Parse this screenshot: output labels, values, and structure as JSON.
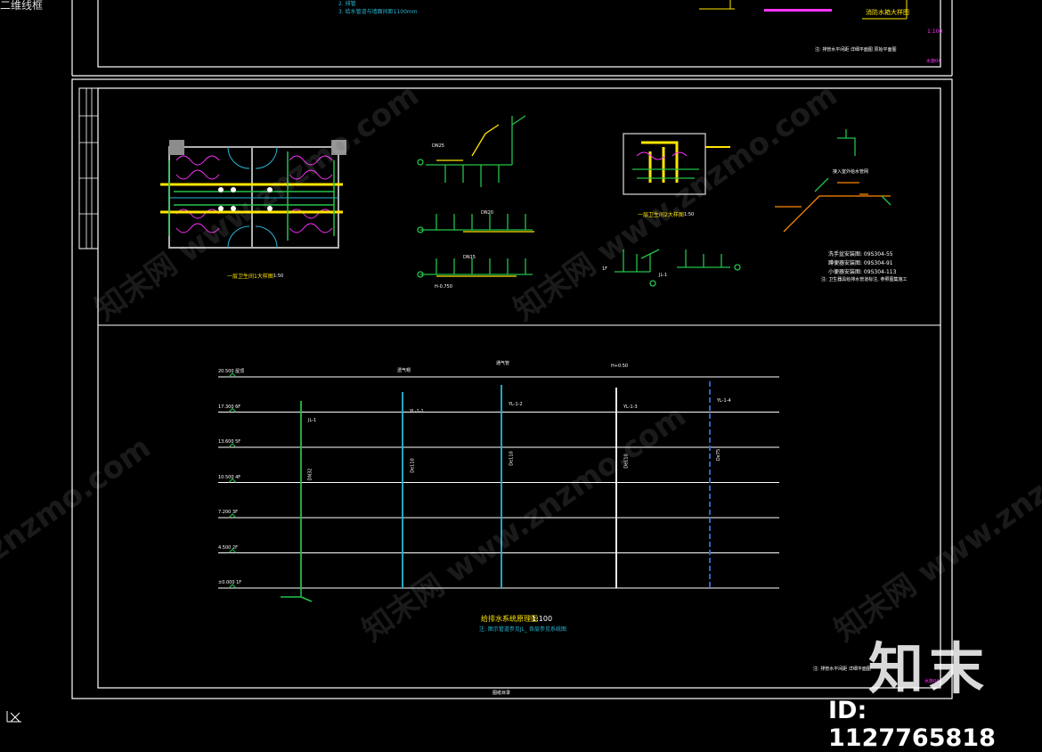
{
  "ui": {
    "viewport_label": "二维线框",
    "ucs_icon": "ucs-axis-icon"
  },
  "top_sheet": {
    "notes": [
      "2. 排管",
      "3. 给水管道与墙面间距1100mm"
    ],
    "title": "消防水箱大样图",
    "scale": "1:100",
    "sheet_no": "水施04",
    "footer": "注: 排管水平间距  详细平面图 原始平面图"
  },
  "sheet": {
    "plan1_title": "一层卫生间1大样图",
    "plan1_scale": "1:50",
    "plan2_title": "一层卫生间2大样图",
    "plan2_scale": "1:50",
    "atlas_lines": [
      "洗手盆安装图: 09S304-55",
      "蹲便器安装图: 09S304-91",
      "小便器安装图: 09S304-113"
    ],
    "atlas_note": "注: 卫生器具给排水管道标注, 参照图集施工",
    "riser_title": "给排水系统原理图",
    "riser_scale": "1:100",
    "riser_note": "注: 图示管道参见JL_ 各层参见系统图",
    "footer_note": "注: 排管水平间距  详细平面图",
    "sheet_no": "水施04",
    "bottom_label": "图纸目录"
  },
  "floors": [
    {
      "elev": "20.500",
      "name": "屋顶"
    },
    {
      "elev": "17.300",
      "name": "6F"
    },
    {
      "elev": "13.600",
      "name": "5F"
    },
    {
      "elev": "10.500",
      "name": "4F"
    },
    {
      "elev": "7.200",
      "name": "3F"
    },
    {
      "elev": "4.500",
      "name": "2F"
    },
    {
      "elev": "±0.000",
      "name": "1F"
    }
  ],
  "risers": [
    {
      "label": "JL-1",
      "color": "#22c24a",
      "top_label": "",
      "size": "DN32"
    },
    {
      "label": "YL-1-1",
      "color": "#29b6d6",
      "top_label": "透气帽",
      "size": "De110"
    },
    {
      "label": "YL-1-2",
      "color": "#29b6d6",
      "top_label": "通气管",
      "size": "De110"
    },
    {
      "label": "YL-1-3",
      "color": "#ffffff",
      "top_label": "H+0.50",
      "size": "De110"
    },
    {
      "label": "YL-1-4",
      "color": "#2a72d6",
      "top_label": "",
      "size": "De75"
    }
  ],
  "iso_labels": [
    "DN25",
    "DN20",
    "DN15",
    "H-0.750",
    "1F",
    "JL-1",
    "接入室外给水管网"
  ],
  "watermarks": [
    "知末网 www.znzmo.com",
    "znzmo.com"
  ],
  "brand": {
    "logo": "知末",
    "id_label": "ID: 1127765818"
  },
  "colors": {
    "background": "#000000",
    "frame": "#ffffff",
    "water_supply": "#22c24a",
    "drain": "#29b6d6",
    "hot_water": "#ffe600",
    "fixture": "#ff33ff",
    "wall": "#b0b0b0",
    "accent_text": "#ffe600"
  }
}
